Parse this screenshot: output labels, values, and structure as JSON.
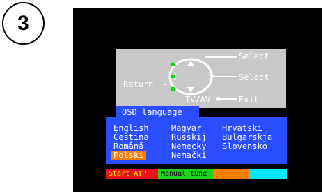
{
  "step": {
    "number": "3"
  },
  "remote": {
    "return_label": "Return",
    "dash": "-",
    "tv_av": "TV/AV",
    "select_top": "Select",
    "select_right": "Select",
    "exit": "Exit",
    "plus": "+"
  },
  "osd": {
    "title": "OSD language",
    "col1": [
      "English",
      "Čeština",
      "Română",
      "Polski"
    ],
    "col2": [
      "Magyar",
      "Russkij",
      "Nemecky",
      "Nemački"
    ],
    "col3": [
      "Hrvatski",
      "Bulgarskja",
      "Slovensko"
    ],
    "selected": "Polski"
  },
  "colour_bar": {
    "red_label": "Start ATP",
    "green_label": "Manual tune",
    "red_color": "#e8141a",
    "green_color": "#1ed21e",
    "yellow_color": "#ff7f00",
    "blue_color": "#00e8ff"
  }
}
